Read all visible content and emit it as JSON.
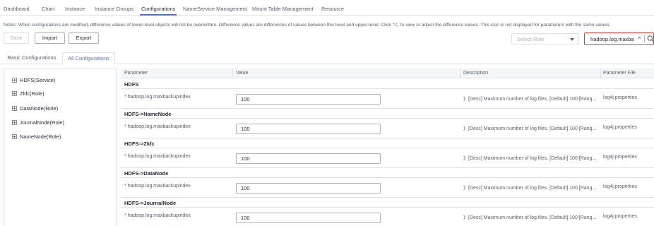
{
  "top_tabs": [
    {
      "label": "Dashboard"
    },
    {
      "label": "Chart"
    },
    {
      "label": "Instance"
    },
    {
      "label": "Instance Groups"
    },
    {
      "label": "Configurations"
    },
    {
      "label": "NameService Management"
    },
    {
      "label": "Mount Table Management"
    },
    {
      "label": "Resource"
    }
  ],
  "active_top_tab": "Configurations",
  "notes": "Notes: When configurations are modified, difference values of lower-level objects will not be overwritten. Difference values are differences of values between this level and upper-level. Click ⌥, to view or adjust the difference values. This icon is not displayed for parameters with the same values.",
  "toolbar": {
    "save_label": "Save",
    "import_label": "Import",
    "export_label": "Export",
    "role_placeholder": "Select Role",
    "search_value": "hadoop.log.maxba...",
    "clear_glyph": "×"
  },
  "sub_tabs": [
    {
      "label": "Basic Configurations"
    },
    {
      "label": "All Configurations"
    }
  ],
  "active_sub_tab": "All Configurations",
  "tree": [
    {
      "label": "HDFS(Service)"
    },
    {
      "label": "Zkfc(Role)"
    },
    {
      "label": "DataNode(Role)"
    },
    {
      "label": "JournalNode(Role)"
    },
    {
      "label": "NameNode(Role)"
    }
  ],
  "table": {
    "headers": {
      "parameter": "Parameter",
      "value": "Value",
      "description": "Description",
      "file": "Parameter File"
    },
    "groups": [
      {
        "label": "HDFS",
        "param": "hadoop.log.maxbackupindex",
        "required_mark": "*",
        "value": "100",
        "description": "》[Desc] Maximum number of log files. [Default] 100 [Rang...",
        "file": "log4j.properties"
      },
      {
        "label": "HDFS->NameNode",
        "param": "hadoop.log.maxbackupindex",
        "required_mark": "*",
        "value": "100",
        "description": "》[Desc] Maximum number of log files. [Default] 100 [Rang...",
        "file": "log4j.properties"
      },
      {
        "label": "HDFS->Zkfc",
        "param": "hadoop.log.maxbackupindex",
        "required_mark": "*",
        "value": "100",
        "description": "》[Desc] Maximum number of log files. [Default] 100 [Rang...",
        "file": "log4j.properties"
      },
      {
        "label": "HDFS->DataNode",
        "param": "hadoop.log.maxbackupindex",
        "required_mark": "*",
        "value": "100",
        "description": "》[Desc] Maximum number of log files. [Default] 100 [Rang...",
        "file": "log4j.properties"
      },
      {
        "label": "HDFS->JournalNode",
        "param": "hadoop.log.maxbackupindex",
        "required_mark": "*",
        "value": "100",
        "description": "》[Desc] Maximum number of log files. [Default] 100 [Rang...",
        "file": "log4j.properties"
      }
    ]
  },
  "colors": {
    "accent": "#526ecc",
    "search_border": "#e53935",
    "required_mark": "#e53935",
    "header_bg": "#f3f6f8"
  }
}
